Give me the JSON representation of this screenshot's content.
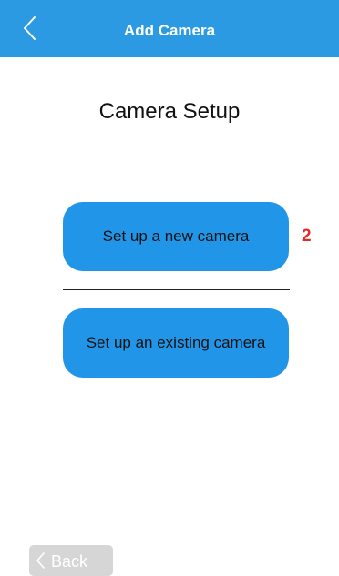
{
  "header": {
    "title": "Add Camera",
    "back_icon": "chevron-left-icon",
    "background_color": "#2b9ae2"
  },
  "main": {
    "heading": "Camera Setup",
    "new_camera_label": "Set up a new camera",
    "existing_camera_label": "Set up an existing camera",
    "step_badge": "2",
    "button_color": "#2196e8",
    "badge_color": "#e12a2a"
  },
  "footer": {
    "back_label": "Back",
    "back_icon": "chevron-left-icon"
  }
}
